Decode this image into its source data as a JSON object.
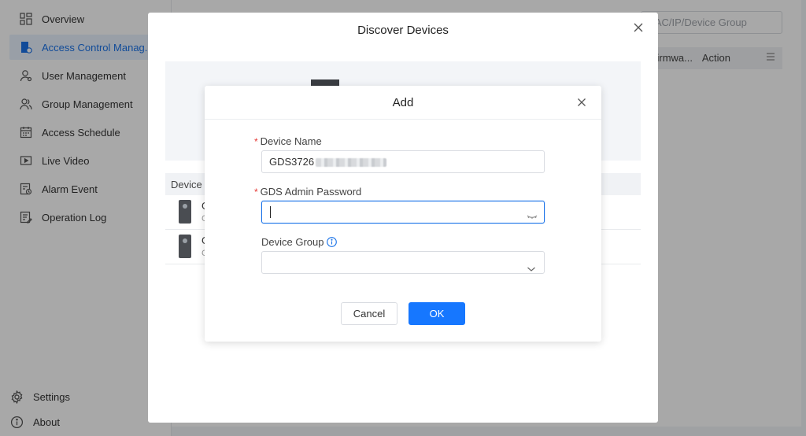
{
  "sidebar": {
    "items": [
      {
        "label": "Overview",
        "icon": "dashboard-icon"
      },
      {
        "label": "Access Control Manag...",
        "icon": "access-control-icon",
        "active": true
      },
      {
        "label": "User Management",
        "icon": "user-icon"
      },
      {
        "label": "Group Management",
        "icon": "group-icon"
      },
      {
        "label": "Access Schedule",
        "icon": "calendar-icon"
      },
      {
        "label": "Live Video",
        "icon": "video-icon"
      },
      {
        "label": "Alarm Event",
        "icon": "alarm-icon"
      },
      {
        "label": "Operation Log",
        "icon": "log-icon"
      }
    ],
    "bottom": {
      "settings_label": "Settings",
      "about_label": "About"
    }
  },
  "main": {
    "search_placeholder": "MAC/IP/Device Group",
    "columns": {
      "firmware": "Firmwa...",
      "action": "Action"
    }
  },
  "discover_dialog": {
    "title": "Discover Devices",
    "device_column": "Device",
    "rows": [
      {
        "line1": "G",
        "line2": "C"
      },
      {
        "line1": "G",
        "line2": "C"
      }
    ]
  },
  "add_dialog": {
    "title": "Add",
    "device_name_label": "Device Name",
    "device_name_value": "GDS3726",
    "password_label": "GDS Admin Password",
    "password_value": "",
    "device_group_label": "Device Group",
    "device_group_value": "",
    "cancel_label": "Cancel",
    "ok_label": "OK"
  },
  "colors": {
    "accent": "#1677ff",
    "required": "#e53935",
    "active_nav_bg": "#e8f1fd"
  }
}
